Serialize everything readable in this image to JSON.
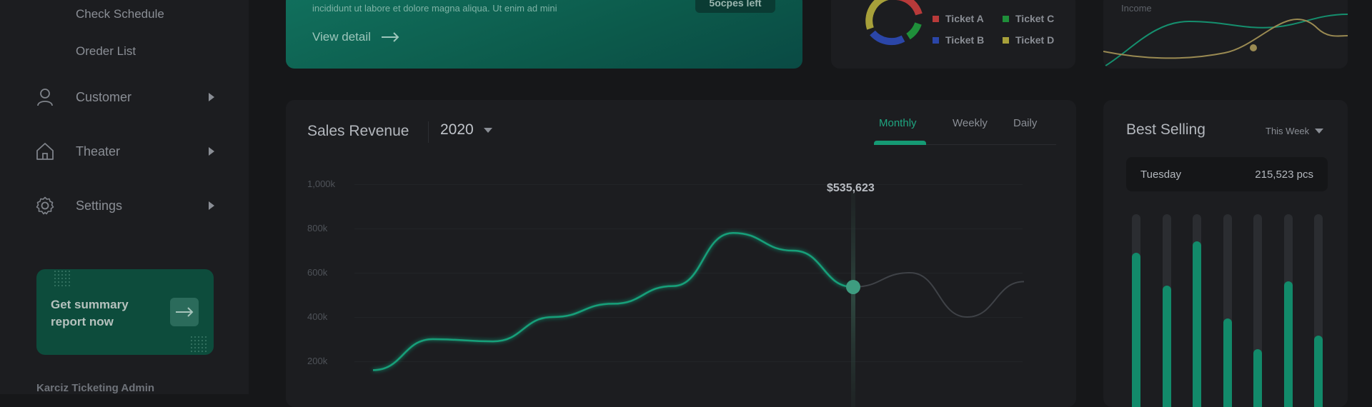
{
  "sidebar": {
    "sub_items": [
      "Check Schedule",
      "Oreder List"
    ],
    "nav": [
      {
        "label": "Customer",
        "icon": "user-icon"
      },
      {
        "label": "Theater",
        "icon": "home-icon"
      },
      {
        "label": "Settings",
        "icon": "gear-icon"
      }
    ],
    "summary": {
      "text": "Get summary report now",
      "icon": "arrow-right-icon"
    },
    "brand": "Karciz Ticketing Admin"
  },
  "banner": {
    "text": "incididunt ut labore et dolore magna aliqua. Ut enim ad mini",
    "view_detail": "View detail",
    "button_label": "5ocpes left"
  },
  "tickets": {
    "legend": [
      {
        "label": "Ticket A",
        "color": "#b83a3a"
      },
      {
        "label": "Ticket B",
        "color": "#2b46a8"
      },
      {
        "label": "Ticket C",
        "color": "#1f8f3a"
      },
      {
        "label": "Ticket D",
        "color": "#a7a03a"
      }
    ]
  },
  "income": {
    "label": "Income"
  },
  "revenue": {
    "title": "Sales Revenue",
    "year": "2020",
    "tabs": [
      "Monthly",
      "Weekly",
      "Daily"
    ],
    "active_tab": "Monthly",
    "tooltip": "$535,623"
  },
  "best_selling": {
    "title": "Best Selling",
    "filter": "This Week",
    "selected_day": "Tuesday",
    "selected_qty": "215,523 pcs",
    "bar_levels": [
      0.8,
      0.63,
      0.86,
      0.46,
      0.3,
      0.65,
      0.37
    ]
  },
  "chart_data": {
    "type": "line",
    "title": "Sales Revenue",
    "ytick_labels": [
      "1,000k",
      "800k",
      "600k",
      "400k",
      "200k"
    ],
    "ylim": [
      0,
      1000000
    ],
    "series": [
      {
        "values": [
          160000,
          300000,
          290000,
          400000,
          460000,
          540000,
          780000,
          700000,
          535623
        ]
      },
      {
        "values": [
          535623,
          600000,
          400000,
          560000
        ]
      }
    ],
    "highlight_value": 535623,
    "colors": {
      "primary": "#17a07a",
      "secondary": "#3f4247"
    }
  }
}
